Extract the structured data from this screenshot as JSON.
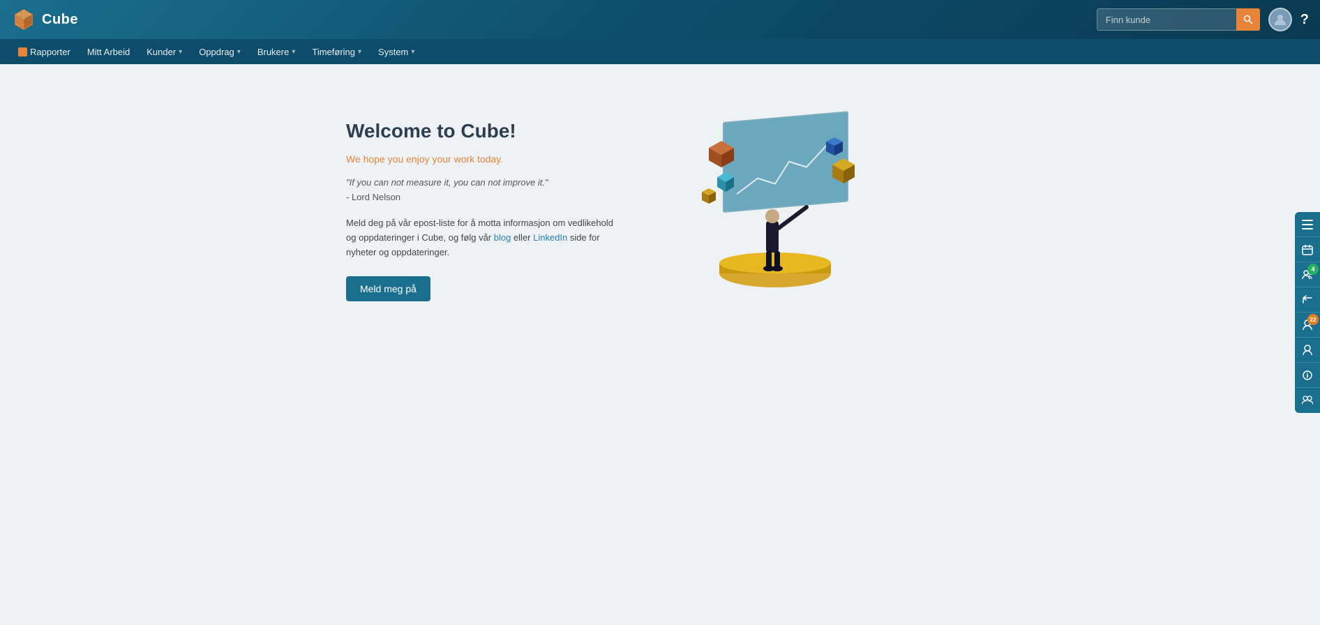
{
  "brand": {
    "name": "Cube"
  },
  "topbar": {
    "search_placeholder": "Finn kunde",
    "search_icon": "🔍",
    "avatar_icon": "👤",
    "help_icon": "?"
  },
  "secondary_nav": {
    "items": [
      {
        "id": "rapporter",
        "label": "Rapporter",
        "has_icon": true,
        "has_dropdown": false
      },
      {
        "id": "mitt-arbeid",
        "label": "Mitt Arbeid",
        "has_icon": false,
        "has_dropdown": false
      },
      {
        "id": "kunder",
        "label": "Kunder",
        "has_icon": false,
        "has_dropdown": true
      },
      {
        "id": "oppdrag",
        "label": "Oppdrag",
        "has_icon": false,
        "has_dropdown": true
      },
      {
        "id": "brukere",
        "label": "Brukere",
        "has_icon": false,
        "has_dropdown": true
      },
      {
        "id": "timeforing",
        "label": "Timeføring",
        "has_icon": false,
        "has_dropdown": true
      },
      {
        "id": "system",
        "label": "System",
        "has_icon": false,
        "has_dropdown": true
      }
    ]
  },
  "welcome": {
    "title": "Welcome to Cube!",
    "subtitle": "We hope you enjoy your work today.",
    "quote": "\"If you can not measure it, you can not improve it.\"",
    "quote_author": "- Lord Nelson",
    "description_part1": "Meld deg på vår epost-liste for å motta informasjon om vedlikehold og oppdateringer i Cube, og følg vår ",
    "description_link1": "blog",
    "description_part2": " eller ",
    "description_link2": "LinkedIn",
    "description_part3": " side for nyheter og oppdateringer.",
    "cta_button": "Meld meg på"
  },
  "right_sidebar": {
    "icons": [
      {
        "id": "menu-icon",
        "label": "≡",
        "badge": null
      },
      {
        "id": "calendar-icon",
        "label": "📅",
        "badge": null
      },
      {
        "id": "users-icon",
        "label": "👥",
        "badge": "4"
      },
      {
        "id": "return-icon",
        "label": "↩",
        "badge": null
      },
      {
        "id": "people-icon",
        "label": "👤",
        "badge": "22"
      },
      {
        "id": "profile-icon",
        "label": "👤",
        "badge": null
      },
      {
        "id": "info-icon",
        "label": "ℹ",
        "badge": null
      },
      {
        "id": "group-icon",
        "label": "👥",
        "badge": null
      }
    ]
  }
}
